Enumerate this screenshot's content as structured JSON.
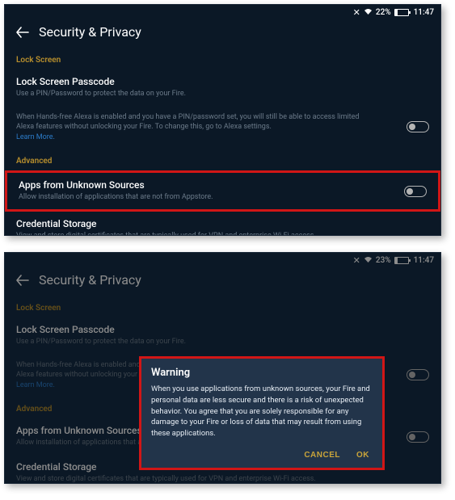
{
  "shot1": {
    "status": {
      "battery_pct": "22%",
      "time": "11:47"
    },
    "title": "Security & Privacy",
    "sections": {
      "lock_screen": {
        "label": "Lock Screen",
        "passcode": {
          "title": "Lock Screen Passcode",
          "desc": "Use a PIN/Password to protect the data on your Fire."
        },
        "alexa_note": {
          "desc_pre": "When Hands-free Alexa is enabled and you have a PIN/password set, you will still be able to access limited Alexa features without unlocking your Fire. To change this, go to Alexa settings.",
          "learn_more": "Learn More."
        }
      },
      "advanced": {
        "label": "Advanced",
        "unknown": {
          "title": "Apps from Unknown Sources",
          "desc": "Allow installation of applications that are not from Appstore."
        },
        "credential": {
          "title": "Credential Storage",
          "desc": "View and store digital certificates that are typically used for VPN and enterprise Wi-Fi access."
        }
      }
    }
  },
  "shot2": {
    "status": {
      "battery_pct": "23%",
      "time": "11:47"
    },
    "title": "Security & Privacy",
    "dialog": {
      "title": "Warning",
      "body": "When you use applications from unknown sources, your Fire and personal data are less secure and there is a risk of unexpected behavior. You agree that you are solely responsible for any damage to your Fire or loss of data that may result from using these applications.",
      "cancel": "CANCEL",
      "ok": "OK"
    }
  }
}
